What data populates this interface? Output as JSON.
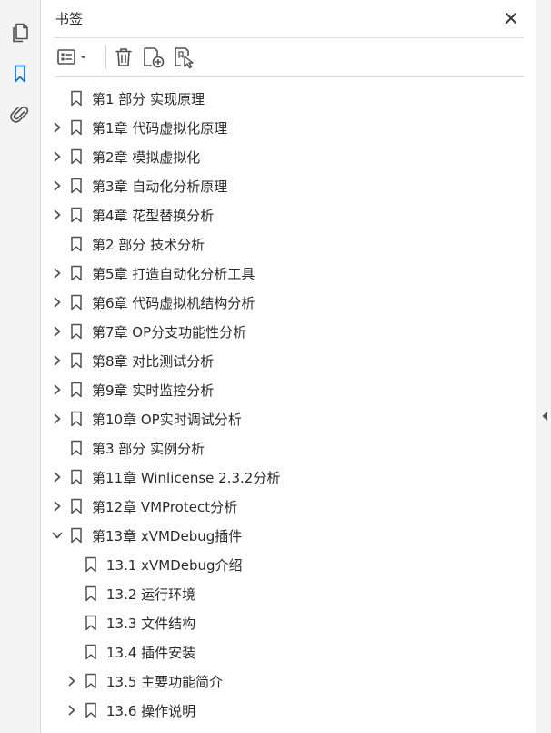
{
  "rail": {
    "items": [
      {
        "name": "pages-icon",
        "active": false
      },
      {
        "name": "bookmark-icon",
        "active": true
      },
      {
        "name": "attachment-icon",
        "active": false
      }
    ]
  },
  "panel": {
    "title": "书签"
  },
  "colors": {
    "accent": "#1473e6",
    "icon": "#505050",
    "text": "#2b2b2b"
  },
  "bookmarks": [
    {
      "label": "第1 部分 实现原理",
      "level": 0,
      "expander": "none"
    },
    {
      "label": "第1章 代码虚拟化原理",
      "level": 0,
      "expander": "collapsed"
    },
    {
      "label": "第2章 模拟虚拟化",
      "level": 0,
      "expander": "collapsed"
    },
    {
      "label": "第3章 自动化分析原理",
      "level": 0,
      "expander": "collapsed"
    },
    {
      "label": "第4章 花型替换分析",
      "level": 0,
      "expander": "collapsed"
    },
    {
      "label": "第2 部分 技术分析",
      "level": 0,
      "expander": "none"
    },
    {
      "label": "第5章 打造自动化分析工具",
      "level": 0,
      "expander": "collapsed"
    },
    {
      "label": "第6章 代码虚拟机结构分析",
      "level": 0,
      "expander": "collapsed"
    },
    {
      "label": "第7章 OP分支功能性分析",
      "level": 0,
      "expander": "collapsed"
    },
    {
      "label": "第8章 对比测试分析",
      "level": 0,
      "expander": "collapsed"
    },
    {
      "label": "第9章 实时监控分析",
      "level": 0,
      "expander": "collapsed"
    },
    {
      "label": "第10章 OP实时调试分析",
      "level": 0,
      "expander": "collapsed"
    },
    {
      "label": "第3 部分 实例分析",
      "level": 0,
      "expander": "none"
    },
    {
      "label": "第11章 Winlicense 2.3.2分析",
      "level": 0,
      "expander": "collapsed"
    },
    {
      "label": "第12章 VMProtect分析",
      "level": 0,
      "expander": "collapsed"
    },
    {
      "label": "第13章 xVMDebug插件",
      "level": 0,
      "expander": "expanded"
    },
    {
      "label": "13.1 xVMDebug介绍",
      "level": 1,
      "expander": "none"
    },
    {
      "label": "13.2 运行环境",
      "level": 1,
      "expander": "none"
    },
    {
      "label": "13.3 文件结构",
      "level": 1,
      "expander": "none"
    },
    {
      "label": "13.4 插件安装",
      "level": 1,
      "expander": "none"
    },
    {
      "label": "13.5 主要功能简介",
      "level": 1,
      "expander": "collapsed"
    },
    {
      "label": "13.6 操作说明",
      "level": 1,
      "expander": "collapsed"
    }
  ]
}
